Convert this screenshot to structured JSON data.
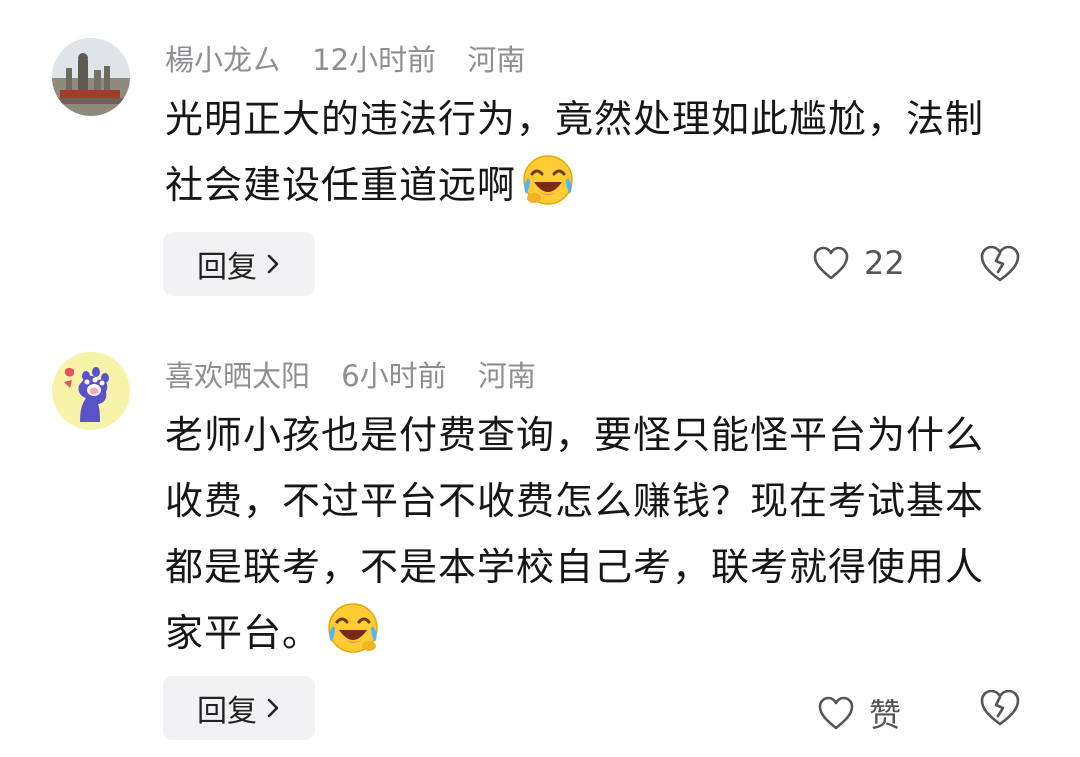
{
  "comments": [
    {
      "username": "楊小龙ㄙ",
      "time": "12小时前",
      "location": "河南",
      "text": "光明正大的违法行为，竟然处理如此尴尬，法制社会建设任重道远啊",
      "emoji": "laugh-cry-emoji",
      "reply_label": "回复",
      "like_count": "22",
      "avatar": "river-statue-photo"
    },
    {
      "username": "喜欢晒太阳",
      "time": "6小时前",
      "location": "河南",
      "text": "老师小孩也是付费查询，要怪只能怪平台为什么收费，不过平台不收费怎么赚钱？现在考试基本都是联考，不是本学校自己考，联考就得使用人家平台。",
      "emoji": "laugh-cry-emoji",
      "reply_label": "回复",
      "like_count": "赞",
      "avatar": "cat-paw-cartoon"
    }
  ],
  "colors": {
    "meta_text": "#8e8e93",
    "reply_bg": "#f2f2f4",
    "icon_stroke": "#555555",
    "paw_bg": "#f7f3a8",
    "paw_purple": "#5a52c8"
  }
}
